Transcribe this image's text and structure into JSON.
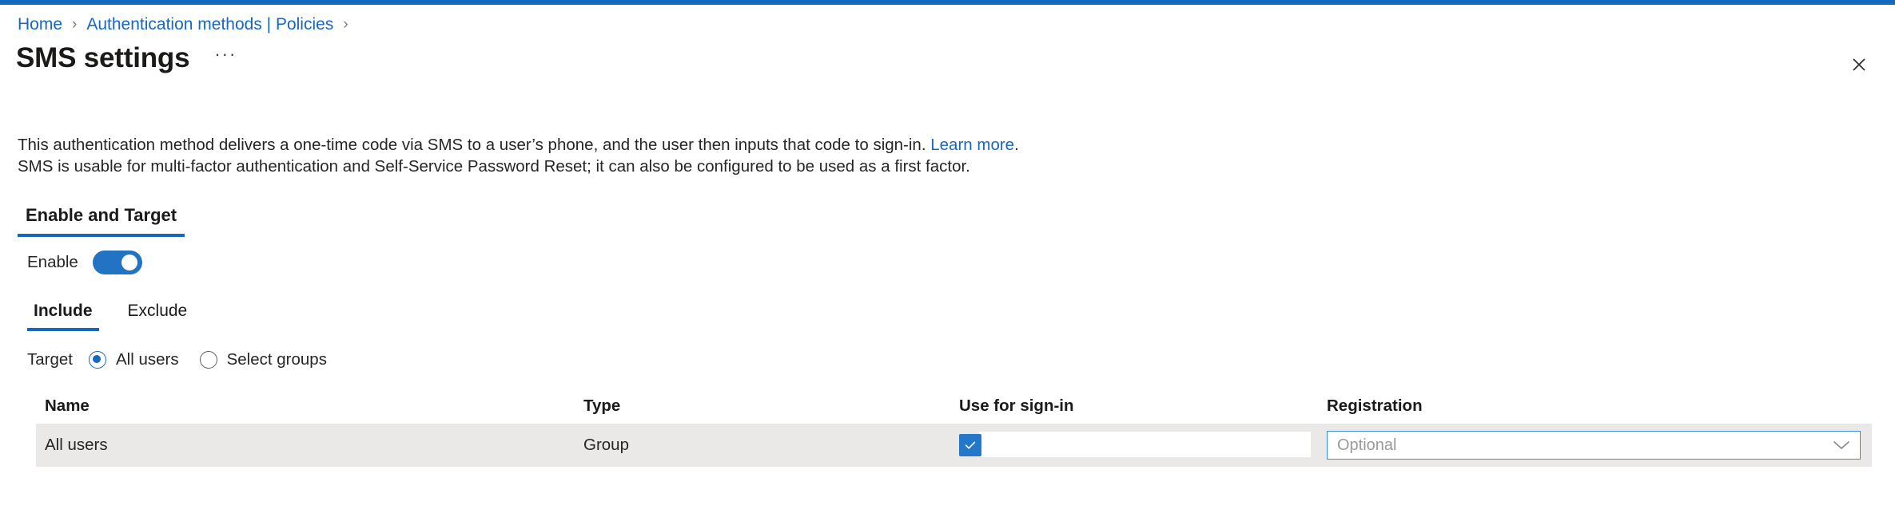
{
  "theme": {
    "accent": "#1668bd",
    "link": "#1867c0",
    "toggle_on": "#2273c4",
    "checkbox_on": "#2378ca",
    "row_background": "#ebe9e7",
    "dropdown_border": "#3f8ed0"
  },
  "breadcrumb": {
    "items": [
      {
        "label": "Home"
      },
      {
        "label": "Authentication methods | Policies"
      }
    ],
    "separator": "›"
  },
  "header": {
    "title": "SMS settings",
    "more_label": "···",
    "more_icon": "ellipsis-icon",
    "close_icon": "close-icon"
  },
  "description": {
    "line1_before_link": "This authentication method delivers a one-time code via SMS to a user’s phone, and the user then inputs that code to sign-in. ",
    "link_label": "Learn more",
    "line1_after_link": ".",
    "line2": "SMS is usable for multi-factor authentication and Self-Service Password Reset; it can also be configured to be used as a first factor."
  },
  "pivot_primary": {
    "items": [
      {
        "label": "Enable and Target",
        "selected": true
      }
    ]
  },
  "enable": {
    "label": "Enable",
    "value": true
  },
  "pivot_secondary": {
    "items": [
      {
        "label": "Include",
        "selected": true
      },
      {
        "label": "Exclude",
        "selected": false
      }
    ]
  },
  "target": {
    "label": "Target",
    "options": [
      {
        "label": "All users",
        "checked": true
      },
      {
        "label": "Select groups",
        "checked": false
      }
    ]
  },
  "grid": {
    "columns": [
      {
        "key": "name",
        "label": "Name"
      },
      {
        "key": "type",
        "label": "Type"
      },
      {
        "key": "signin",
        "label": "Use for sign-in"
      },
      {
        "key": "registration",
        "label": "Registration"
      }
    ],
    "rows": [
      {
        "name": "All users",
        "type": "Group",
        "signin_checked": true,
        "registration_value": "Optional"
      }
    ]
  }
}
